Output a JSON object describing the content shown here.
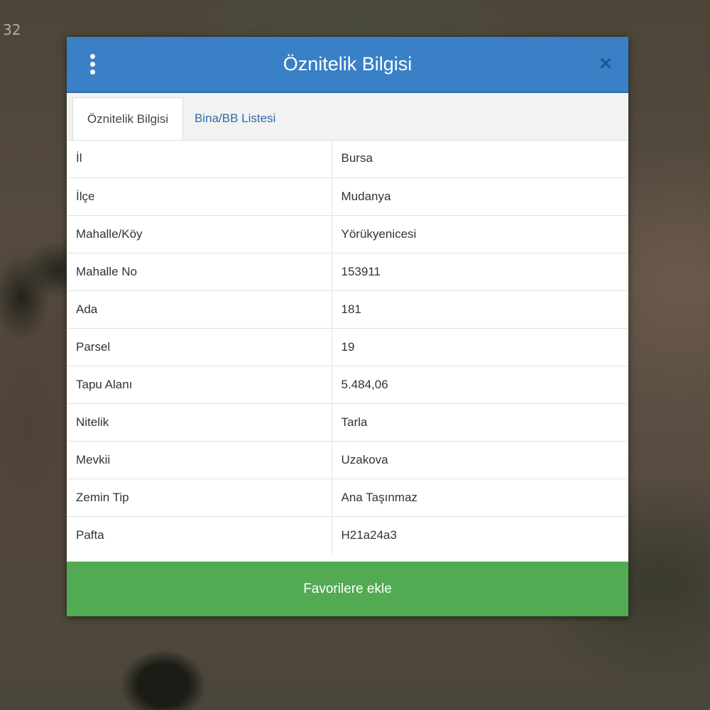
{
  "map": {
    "coordinate_fragment": "32"
  },
  "dialog": {
    "title": "Öznitelik Bilgisi",
    "menu_icon": "vertical-ellipsis-icon",
    "close_icon": "close-icon",
    "close_glyph": "×",
    "tabs": [
      {
        "label": "Öznitelik Bilgisi",
        "active": true
      },
      {
        "label": "Bina/BB Listesi",
        "active": false
      }
    ],
    "rows": [
      {
        "key": "İl",
        "value": "Bursa"
      },
      {
        "key": "İlçe",
        "value": "Mudanya"
      },
      {
        "key": "Mahalle/Köy",
        "value": "Yörükyenicesi"
      },
      {
        "key": "Mahalle No",
        "value": "153911"
      },
      {
        "key": "Ada",
        "value": "181"
      },
      {
        "key": "Parsel",
        "value": "19"
      },
      {
        "key": "Tapu Alanı",
        "value": "5.484,06"
      },
      {
        "key": "Nitelik",
        "value": "Tarla"
      },
      {
        "key": "Mevkii",
        "value": "Uzakova"
      },
      {
        "key": "Zemin Tip",
        "value": "Ana Taşınmaz"
      },
      {
        "key": "Pafta",
        "value": "H21a24a3"
      }
    ],
    "favorite_button_label": "Favorilere ekle"
  },
  "colors": {
    "header": "#3a80c6",
    "close_icon": "#24568c",
    "tab_link": "#2f6ba8",
    "favorite_button": "#52ab52"
  }
}
